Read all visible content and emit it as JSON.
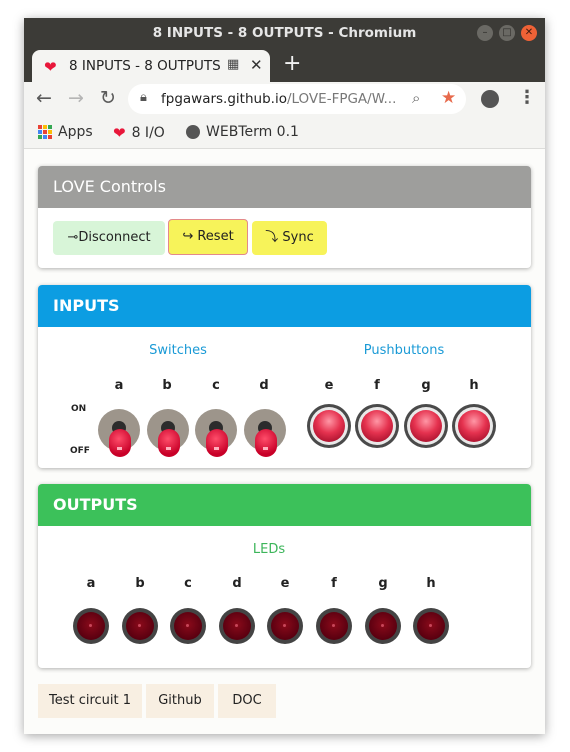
{
  "window": {
    "title": "8 INPUTS - 8 OUTPUTS - Chromium",
    "controls": [
      "minimize-icon",
      "maximize-icon",
      "close-icon"
    ]
  },
  "tab": {
    "title": "8 INPUTS - 8 OUTPUTS",
    "favicon": "heart-icon",
    "new_tab": "+"
  },
  "address": {
    "domain": "fpgawars.github.io",
    "path": "/LOVE-FPGA/W..."
  },
  "bookmarks": [
    {
      "label": "Apps",
      "icon": "apps-grid-icon"
    },
    {
      "label": "8 I/O",
      "icon": "heart-icon"
    },
    {
      "label": "WEBTerm 0.1",
      "icon": "globe-icon"
    }
  ],
  "controls_panel": {
    "title": "LOVE Controls",
    "header_color": "#9e9e9c",
    "disconnect": {
      "icon": "⊸",
      "label": "Disconnect"
    },
    "reset": {
      "icon": "↪",
      "label": "Reset"
    },
    "sync": {
      "icon": "⤵",
      "label": "Sync"
    }
  },
  "inputs_panel": {
    "title": "INPUTS",
    "header_color": "#0c9de2",
    "switches_label": "Switches",
    "pushbuttons_label": "Pushbuttons",
    "on_label": "ON",
    "off_label": "OFF",
    "switches": [
      "a",
      "b",
      "c",
      "d"
    ],
    "pushbuttons": [
      "e",
      "f",
      "g",
      "h"
    ]
  },
  "outputs_panel": {
    "title": "OUTPUTS",
    "header_color": "#3cc15a",
    "leds_label": "LEDs",
    "leds": [
      "a",
      "b",
      "c",
      "d",
      "e",
      "f",
      "g",
      "h"
    ]
  },
  "footer": [
    "Test circuit 1",
    "Github",
    "DOC"
  ]
}
